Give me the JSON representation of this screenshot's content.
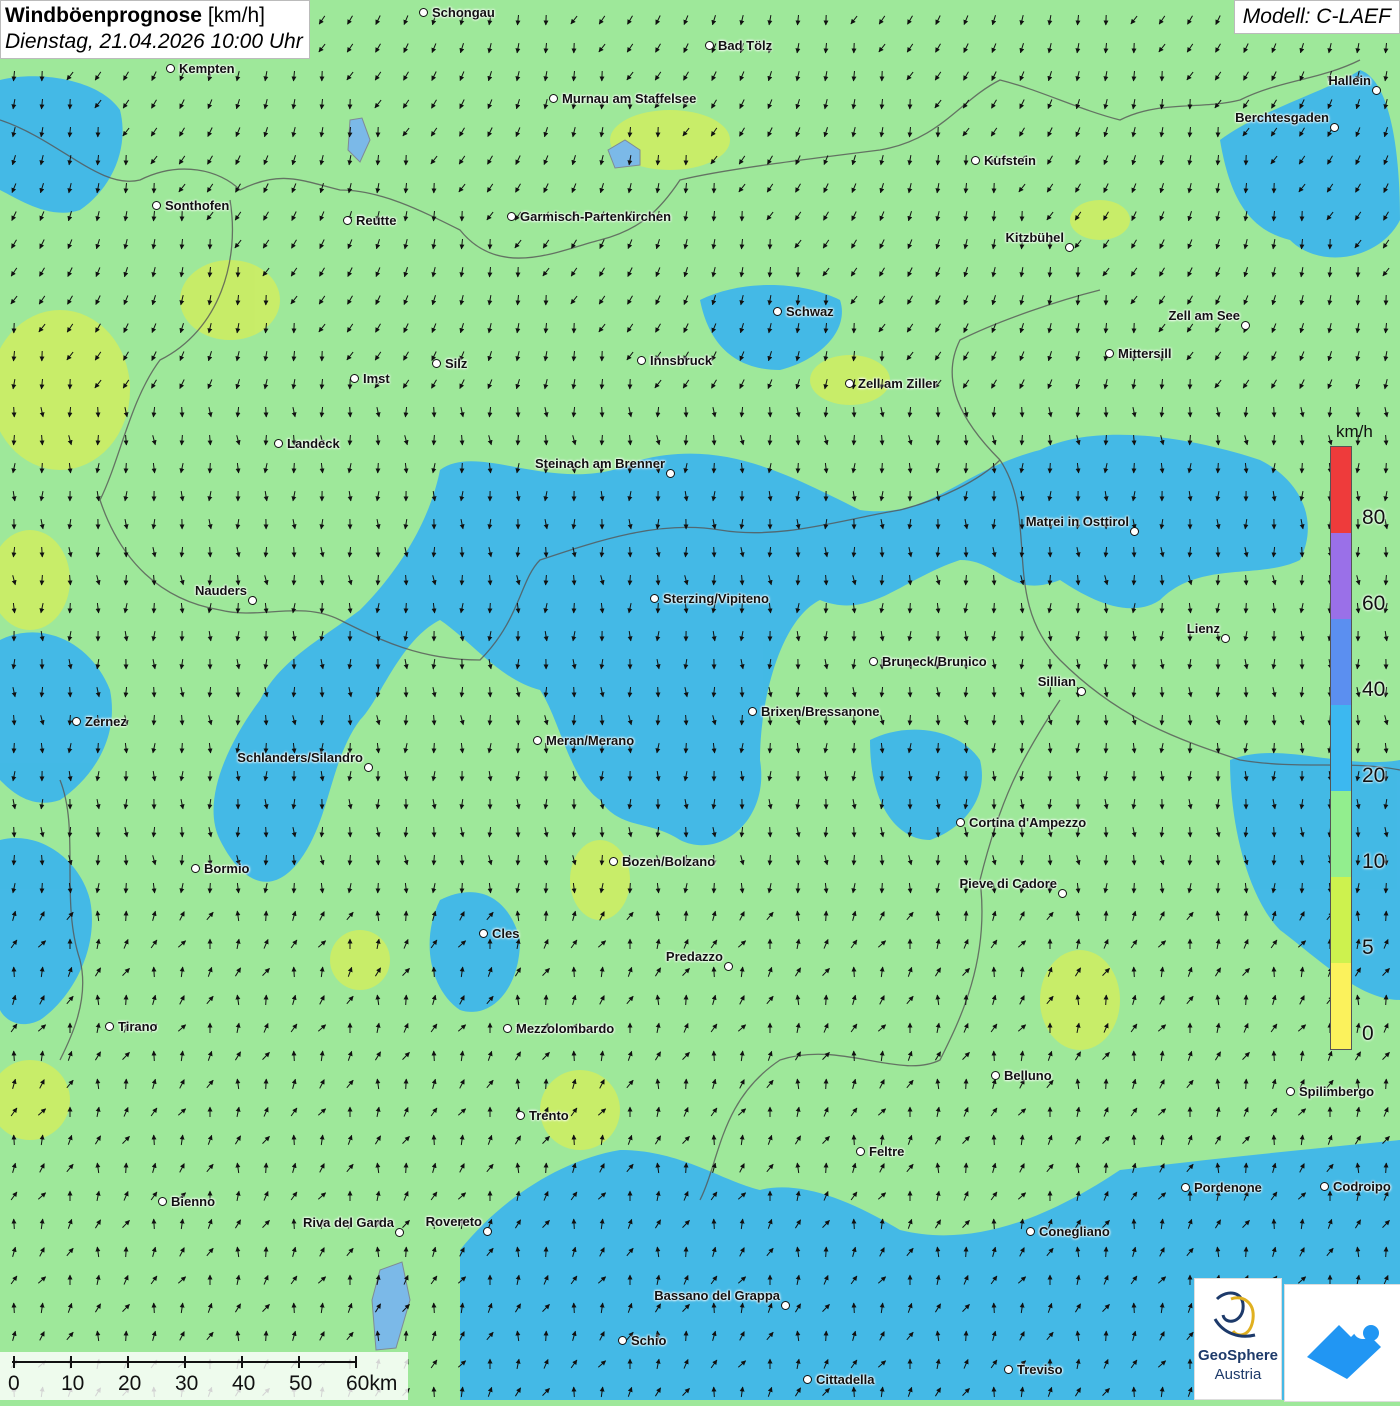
{
  "title": {
    "main": "Windböenprognose",
    "unit": "[km/h]",
    "datetime": "Dienstag, 21.04.2026 10:00 Uhr"
  },
  "model": "Modell: C-LAEF",
  "legend": {
    "unit": "km/h",
    "labels": [
      "80",
      "60",
      "40",
      "20",
      "10",
      "5",
      "0"
    ],
    "colors": [
      "#ee3b3b",
      "#9a70e8",
      "#5b8ff0",
      "#3cb8f0",
      "#92ee8e",
      "#cdf24e",
      "#fbf25c"
    ]
  },
  "scale_bar": {
    "labels": [
      "0",
      "10",
      "20",
      "30",
      "40",
      "50",
      "60km"
    ]
  },
  "logos": {
    "geosphere_line1": "GeoSphere",
    "geosphere_line2": "Austria",
    "geosphere_icon": "geosphere-logo-icon",
    "second_icon": "mountain-cloud-logo-icon"
  },
  "cities": [
    "Schongau",
    "Bad Tölz",
    "Kempten",
    "Murnau am Staffelsee",
    "Hallein",
    "Berchtesgaden",
    "Kufstein",
    "Sonthofen",
    "Reutte",
    "Garmisch-Partenkirchen",
    "Kitzbühel",
    "Schwaz",
    "Zell am See",
    "Mittersill",
    "Innsbruck",
    "Silz",
    "Imst",
    "Zell am Ziller",
    "Landeck",
    "Steinach am Brenner",
    "Matrei in Osttirol",
    "Nauders",
    "Sterzing/Vipiteno",
    "Lienz",
    "Bruneck/Brunico",
    "Sillian",
    "Brixen/Bressanone",
    "Zernez",
    "Meran/Merano",
    "Schlanders/Silandro",
    "Cortina d'Ampezzo",
    "Bozen/Bolzano",
    "Bormio",
    "Pieve di Cadore",
    "Cles",
    "Predazzo",
    "Tirano",
    "Mezzolombardo",
    "Belluno",
    "Spilimbergo",
    "Trento",
    "Feltre",
    "Bienno",
    "Pordenone",
    "Codroipo",
    "Riva del Garda",
    "Rovereto",
    "Conegliano",
    "Bassano del Grappa",
    "Schio",
    "Treviso",
    "Cittadella"
  ]
}
